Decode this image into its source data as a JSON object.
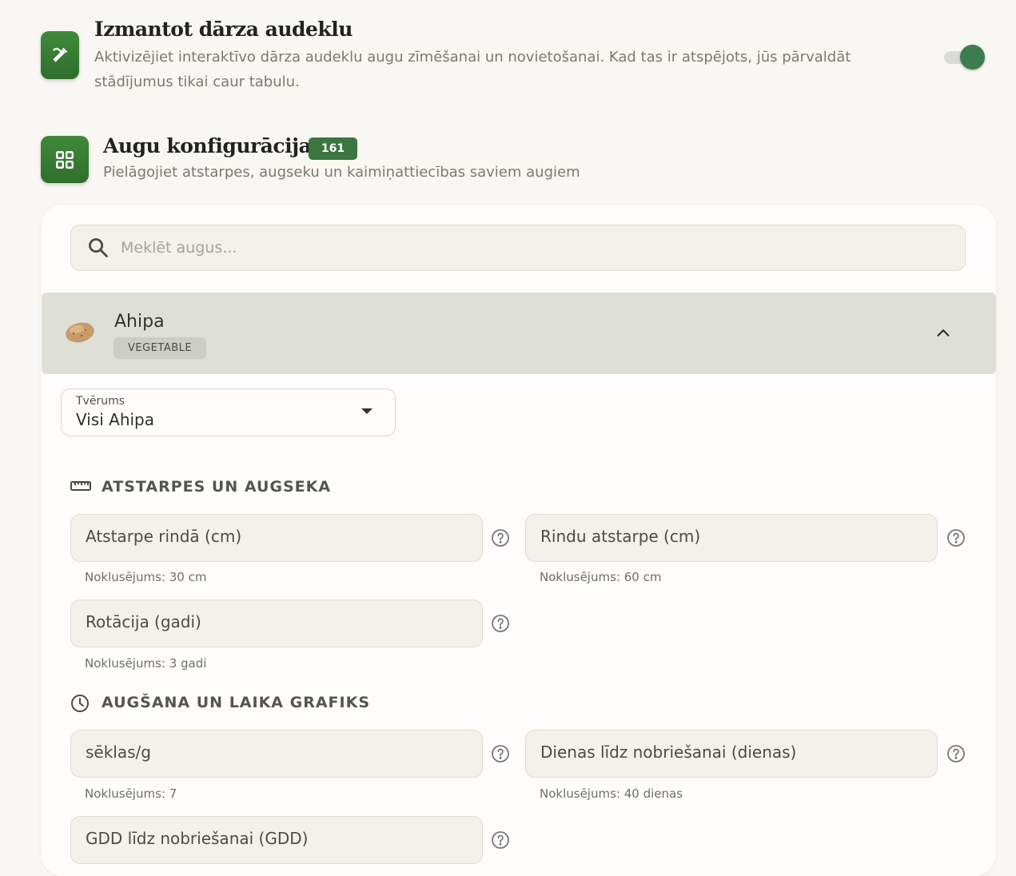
{
  "canvas": {
    "title": "Izmantot dārza audeklu",
    "description": "Aktivizējiet interaktīvo dārza audeklu augu zīmēšanai un novietošanai. Kad tas ir atspējots, jūs pārvaldāt stādījumus tikai caur tabulu.",
    "enabled": true
  },
  "plant_config": {
    "title": "Augu konfigurācija",
    "count": "161",
    "description": "Pielāgojiet atstarpes, augseku un kaimiņattiecības saviem augiem"
  },
  "search": {
    "placeholder": "Meklēt augus..."
  },
  "plant": {
    "name": "Ahipa",
    "type": "VEGETABLE",
    "expanded": true
  },
  "scope": {
    "label": "Tvērums",
    "value": "Visi Ahipa"
  },
  "spacing": {
    "title": "ATSTARPES UN AUGSEKA",
    "fields": [
      {
        "label": "Atstarpe rindā (cm)",
        "hint": "Noklusējums: 30 cm"
      },
      {
        "label": "Rindu atstarpe (cm)",
        "hint": "Noklusējums: 60 cm"
      },
      {
        "label": "Rotācija (gadi)",
        "hint": "Noklusējums: 3 gadi"
      }
    ]
  },
  "growth": {
    "title": "AUGŠANA UN LAIKA GRAFIKS",
    "fields": [
      {
        "label": "sēklas/g",
        "hint": "Noklusējums: 7"
      },
      {
        "label": "Dienas līdz nobriešanai (dienas)",
        "hint": "Noklusējums: 40 dienas"
      },
      {
        "label": "GDD līdz nobriešanai (GDD)"
      }
    ]
  },
  "colors": {
    "accent": "#3b7540",
    "toggle_on": "#3b7d4f"
  }
}
